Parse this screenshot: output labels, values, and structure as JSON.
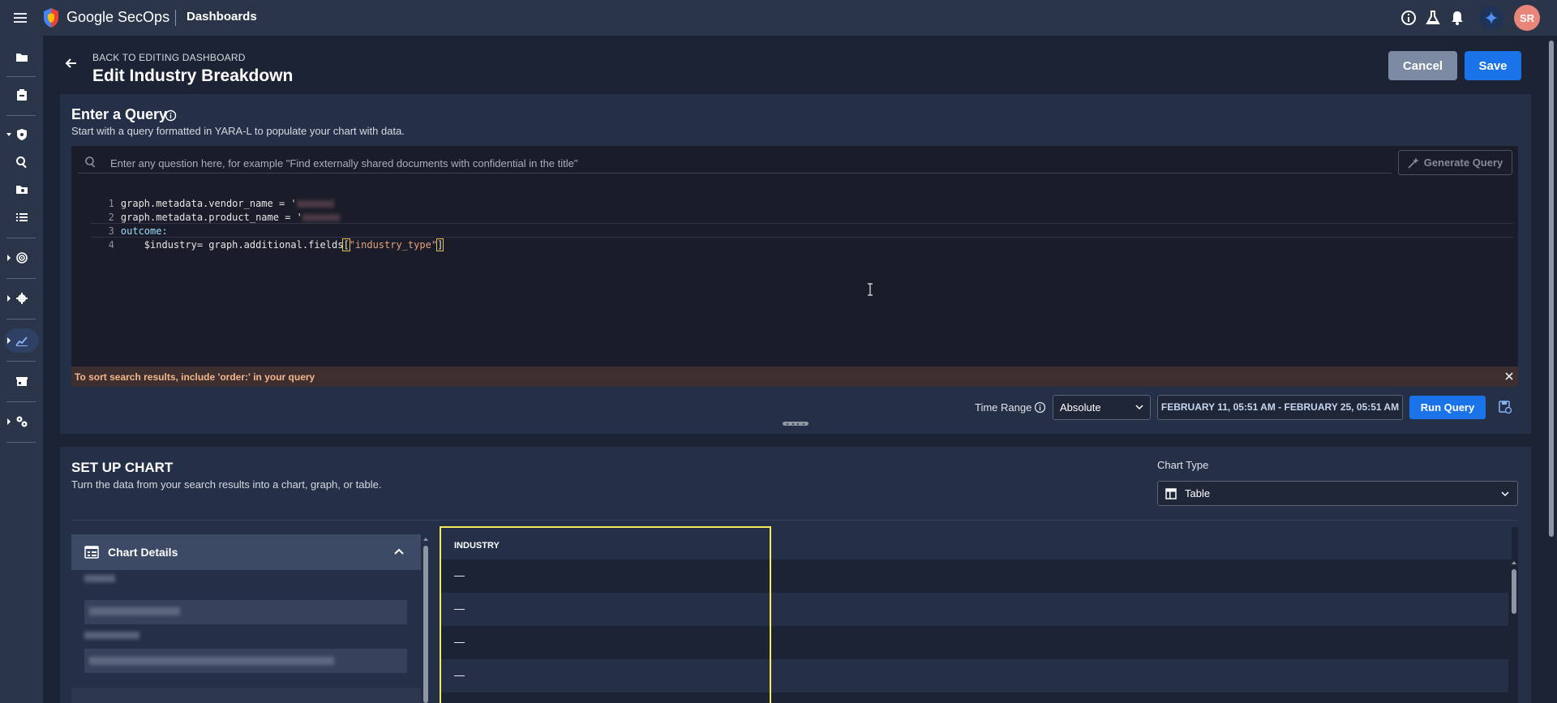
{
  "app": {
    "brand": "Google SecOps",
    "section": "Dashboards",
    "avatar_initials": "SR"
  },
  "header": {
    "back_link": "BACK TO EDITING DASHBOARD",
    "title": "Edit Industry Breakdown",
    "cancel_label": "Cancel",
    "save_label": "Save"
  },
  "query": {
    "title": "Enter a Query",
    "subtitle": "Start with a query formatted in YARA-L to populate your chart with data.",
    "ask_placeholder": "Enter any question here, for example \"Find externally shared documents with confidential in the title\"",
    "generate_label": "Generate Query",
    "code_lines": [
      {
        "num": "1",
        "text": "graph.metadata.vendor_name = '"
      },
      {
        "num": "2",
        "text": "graph.metadata.product_name = '"
      },
      {
        "num": "3",
        "text": "outcome:"
      },
      {
        "num": "4",
        "var": "    $industry",
        "expr": "= graph.additional.fields",
        "lb": "[",
        "str": "\"industry_type\"",
        "rb": "]"
      }
    ],
    "warning": "To sort search results, include 'order:' in your query",
    "time_range_label": "Time Range",
    "time_range_mode": "Absolute",
    "time_range_value": "FEBRUARY 11, 05:51 AM - FEBRUARY 25, 05:51 AM",
    "run_label": "Run Query"
  },
  "chart": {
    "title": "SET UP CHART",
    "subtitle": "Turn the data from your search results into a chart, graph, or table.",
    "type_label": "Chart Type",
    "type_value": "Table",
    "details_label": "Chart Details",
    "table": {
      "column": "INDUSTRY",
      "rows": [
        "—",
        "—",
        "—",
        "—"
      ]
    }
  },
  "colors": {
    "accent": "#1a73e8",
    "highlight": "#f4ea5a",
    "warning_text": "#f3b78c"
  },
  "icons": [
    "menu-icon",
    "shield-logo-icon",
    "info-icon",
    "flask-icon",
    "bell-icon",
    "sparkle-icon",
    "arrow-back-icon",
    "search-icon",
    "wand-icon",
    "close-icon",
    "chevron-down-icon",
    "table-icon",
    "chevron-up-icon",
    "save-query-icon"
  ]
}
